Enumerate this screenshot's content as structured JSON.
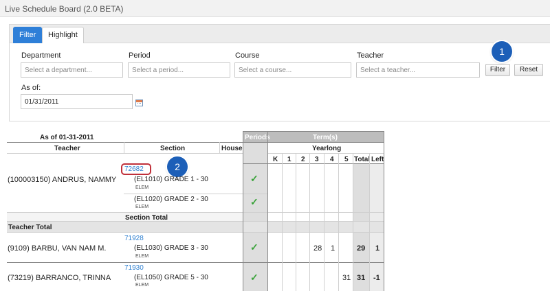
{
  "app": {
    "title": "Live Schedule Board (2.0 BETA)"
  },
  "tabs": {
    "filter": "Filter",
    "highlight": "Highlight"
  },
  "filters": {
    "department": {
      "label": "Department",
      "placeholder": "Select a department..."
    },
    "period": {
      "label": "Period",
      "placeholder": "Select a period..."
    },
    "course": {
      "label": "Course",
      "placeholder": "Select a course..."
    },
    "teacher": {
      "label": "Teacher",
      "placeholder": "Select a teacher..."
    },
    "as_of": {
      "label": "As of:",
      "value": "01/31/2011"
    },
    "filter_button": "Filter",
    "reset_button": "Reset"
  },
  "callouts": {
    "one": "1",
    "two": "2"
  },
  "table": {
    "as_of_title": "As of 01-31-2011",
    "headers": {
      "teacher": "Teacher",
      "section": "Section",
      "house": "House",
      "periods": "Periods",
      "terms": "Term(s)",
      "yearlong": "Yearlong",
      "grades": [
        "K",
        "1",
        "2",
        "3",
        "4",
        "5"
      ],
      "total": "Total",
      "left": "Left"
    },
    "section_total_label": "Section Total",
    "teacher_total_label": "Teacher Total",
    "rows": [
      {
        "teacher": "(100003150) ANDRUS, NAMMY",
        "section_id": "72682",
        "course1": "(EL1010) GRADE 1 - 30",
        "type1": "ELEM",
        "course2": "(EL1020) GRADE 2 - 30",
        "type2": "ELEM"
      },
      {
        "teacher": "(9109) BARBU, VAN NAM M.",
        "section_id": "71928",
        "course": "(EL1030) GRADE 3 - 30",
        "type": "ELEM",
        "g3": "28",
        "g4": "1",
        "total": "29",
        "left": "1"
      },
      {
        "teacher": "(73219) BARRANCO, TRINNA",
        "section_id": "71930",
        "course": "(EL1050) GRADE 5 - 30",
        "type": "ELEM",
        "g5": "31",
        "total": "31",
        "left": "-1"
      }
    ]
  }
}
